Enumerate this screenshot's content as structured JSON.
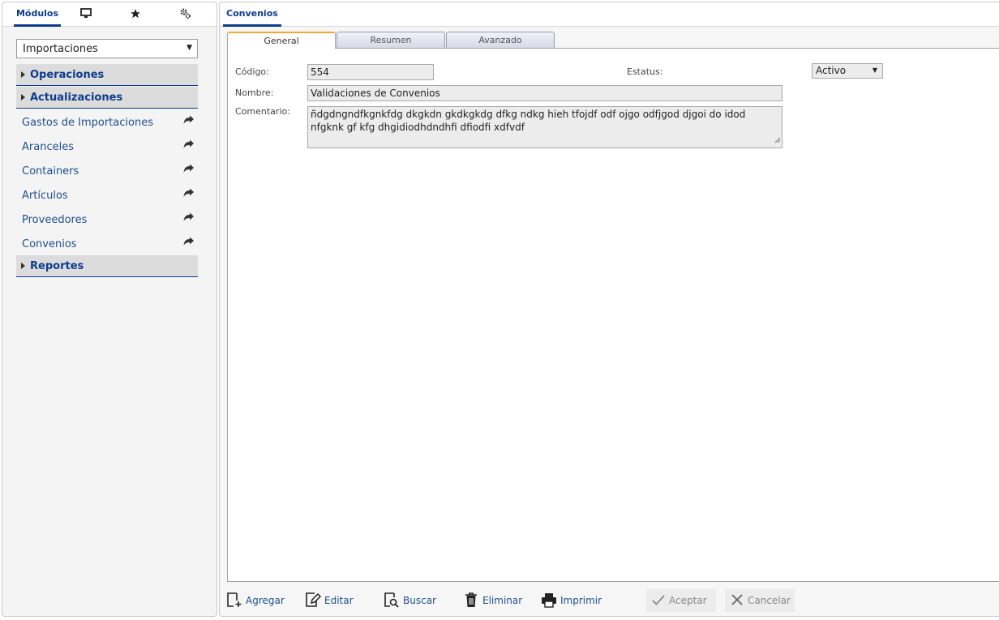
{
  "left": {
    "tabs": {
      "modulos": "Módulos"
    },
    "module_select": "Importaciones",
    "sections": [
      "Operaciones",
      "Actualizaciones",
      "Reportes"
    ],
    "items": [
      "Gastos de Importaciones",
      "Aranceles",
      "Containers",
      "Artículos",
      "Proveedores",
      "Convenios"
    ]
  },
  "right": {
    "title": "Convenios",
    "tabs": [
      "General",
      "Resumen",
      "Avanzado"
    ],
    "form": {
      "codigo_label": "Código:",
      "codigo_value": "554",
      "estatus_label": "Estatus:",
      "estatus_value": "Activo",
      "nombre_label": "Nombre:",
      "nombre_value": "Validaciones de Convenios",
      "comentario_label": "Comentario:",
      "comentario_value": "ñdgdngndfkgnkfdg dkgkdn gkdkgkdg dfkg ndkg hieh tfojdf odf ojgo odfjgod djgoi do idod nfgknk gf kfg dhgidiodhdndhfi dfiodfi xdfvdf"
    },
    "toolbar": {
      "agregar": "Agregar",
      "editar": "Editar",
      "buscar": "Buscar",
      "eliminar": "Eliminar",
      "imprimir": "Imprimir",
      "aceptar": "Aceptar",
      "cancelar": "Cancelar"
    }
  },
  "colors": {
    "accent": "#0d3c8c",
    "tab_active_top": "#f0a830",
    "link": "#1e4f8c"
  }
}
